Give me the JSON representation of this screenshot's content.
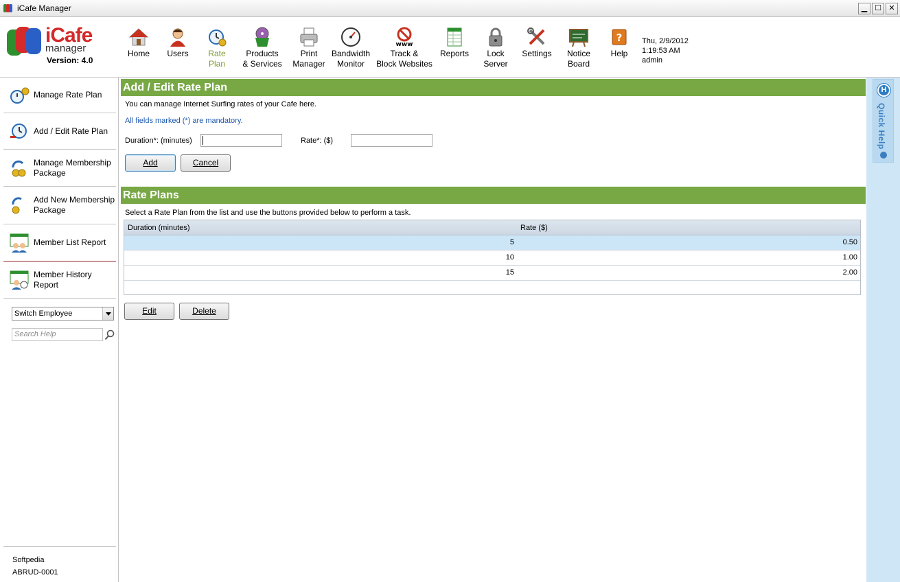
{
  "window": {
    "title": "iCafe Manager",
    "minimize": "▁",
    "maximize": "☐",
    "close": "✕"
  },
  "logo": {
    "line1": "iCafe",
    "line2": "manager",
    "version": "Version: 4.0"
  },
  "toolbar": [
    {
      "id": "home",
      "line1": "Home",
      "line2": ""
    },
    {
      "id": "users",
      "line1": "Users",
      "line2": ""
    },
    {
      "id": "rate-plan",
      "line1": "Rate",
      "line2": "Plan"
    },
    {
      "id": "products",
      "line1": "Products",
      "line2": "& Services"
    },
    {
      "id": "print",
      "line1": "Print",
      "line2": "Manager"
    },
    {
      "id": "bandwidth",
      "line1": "Bandwidth",
      "line2": "Monitor"
    },
    {
      "id": "track",
      "line1": "Track &",
      "line2": "Block Websites"
    },
    {
      "id": "reports",
      "line1": "Reports",
      "line2": ""
    },
    {
      "id": "lock",
      "line1": "Lock",
      "line2": "Server"
    },
    {
      "id": "settings",
      "line1": "Settings",
      "line2": ""
    },
    {
      "id": "notice",
      "line1": "Notice",
      "line2": "Board"
    },
    {
      "id": "help",
      "line1": "Help",
      "line2": ""
    }
  ],
  "datetime": {
    "date": "Thu, 2/9/2012",
    "time": "1:19:53 AM",
    "user": "admin"
  },
  "sidebar": {
    "items": [
      {
        "label1": "Manage Rate Plan",
        "label2": ""
      },
      {
        "label1": "Add / Edit Rate Plan",
        "label2": ""
      },
      {
        "label1": "Manage Membership",
        "label2": "Package"
      },
      {
        "label1": "Add New Membership",
        "label2": "Package"
      },
      {
        "label1": "Member List Report",
        "label2": ""
      },
      {
        "label1": "Member History",
        "label2": "Report"
      }
    ],
    "switch_employee": "Switch Employee",
    "search_placeholder": "Search Help",
    "footer_name": "Softpedia",
    "footer_id": "ABRUD-0001"
  },
  "add_edit": {
    "heading": "Add / Edit Rate Plan",
    "description": "You can manage Internet Surfing rates of your Cafe here.",
    "mandatory_note": "All fields marked (*) are mandatory.",
    "duration_label": "Duration*: (minutes)",
    "rate_label": "Rate*: ($)",
    "add_button": "Add",
    "cancel_button": "Cancel"
  },
  "rate_plans": {
    "heading": "Rate Plans",
    "description": "Select a Rate Plan from the list and use the buttons provided below to perform a task.",
    "columns": [
      "Duration  (minutes)",
      "Rate  ($)"
    ],
    "rows": [
      {
        "duration": "5",
        "rate": "0.50"
      },
      {
        "duration": "10",
        "rate": "1.00"
      },
      {
        "duration": "15",
        "rate": "2.00"
      }
    ],
    "edit_button": "Edit",
    "delete_button": "Delete"
  },
  "quick_help": {
    "label": "Quick Help"
  },
  "colors": {
    "section_header": "#77a844",
    "selected_row": "#cde6f7",
    "quick_help_bg": "#cfe6f6",
    "link_blue": "#1c57b0"
  }
}
